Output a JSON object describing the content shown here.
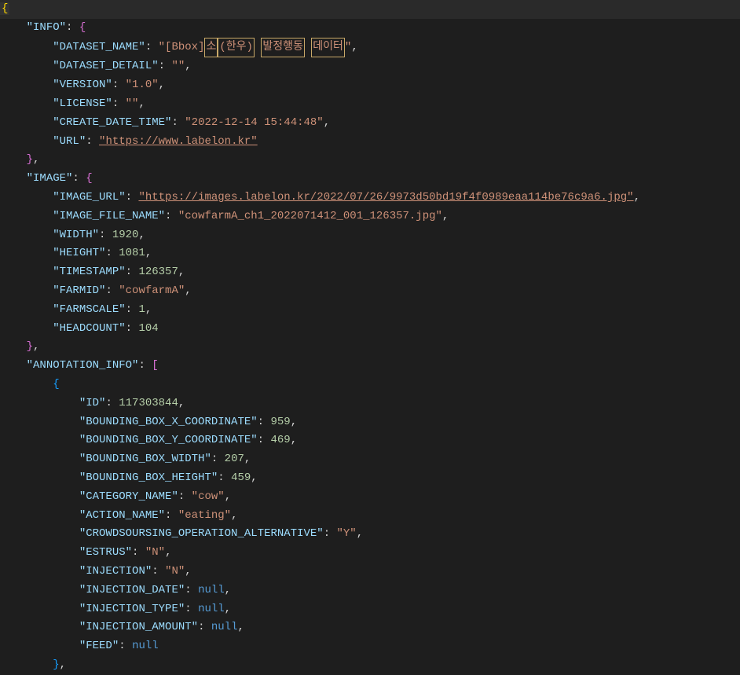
{
  "code": {
    "info_key": "\"INFO\"",
    "dataset_name_key": "\"DATASET_NAME\"",
    "dataset_name_val_prefix": "\"[Bbox]",
    "dataset_name_k1": "소",
    "dataset_name_k2": "(한우)",
    "dataset_name_k3": "발정행동",
    "dataset_name_k4": "데이터",
    "dataset_name_val_suffix": "\"",
    "dataset_detail_key": "\"DATASET_DETAIL\"",
    "dataset_detail_val": "\"\"",
    "version_key": "\"VERSION\"",
    "version_val": "\"1.0\"",
    "license_key": "\"LICENSE\"",
    "license_val": "\"\"",
    "create_date_key": "\"CREATE_DATE_TIME\"",
    "create_date_val": "\"2022-12-14 15:44:48\"",
    "url_key": "\"URL\"",
    "url_val": "\"https://www.labelon.kr\"",
    "image_key": "\"IMAGE\"",
    "image_url_key": "\"IMAGE_URL\"",
    "image_url_val": "\"https://images.labelon.kr/2022/07/26/9973d50bd19f4f0989eaa114be76c9a6.jpg\"",
    "image_file_name_key": "\"IMAGE_FILE_NAME\"",
    "image_file_name_val": "\"cowfarmA_ch1_2022071412_001_126357.jpg\"",
    "width_key": "\"WIDTH\"",
    "width_val": "1920",
    "height_key": "\"HEIGHT\"",
    "height_val": "1081",
    "timestamp_key": "\"TIMESTAMP\"",
    "timestamp_val": "126357",
    "farmid_key": "\"FARMID\"",
    "farmid_val": "\"cowfarmA\"",
    "farmscale_key": "\"FARMSCALE\"",
    "farmscale_val": "1",
    "headcount_key": "\"HEADCOUNT\"",
    "headcount_val": "104",
    "annotation_info_key": "\"ANNOTATION_INFO\"",
    "id_key": "\"ID\"",
    "id_val": "117303844",
    "bbox_x_key": "\"BOUNDING_BOX_X_COORDINATE\"",
    "bbox_x_val": "959",
    "bbox_y_key": "\"BOUNDING_BOX_Y_COORDINATE\"",
    "bbox_y_val": "469",
    "bbox_w_key": "\"BOUNDING_BOX_WIDTH\"",
    "bbox_w_val": "207",
    "bbox_h_key": "\"BOUNDING_BOX_HEIGHT\"",
    "bbox_h_val": "459",
    "category_key": "\"CATEGORY_NAME\"",
    "category_val": "\"cow\"",
    "action_key": "\"ACTION_NAME\"",
    "action_val": "\"eating\"",
    "crowd_key": "\"CROWDSOURSING_OPERATION_ALTERNATIVE\"",
    "crowd_val": "\"Y\"",
    "estrus_key": "\"ESTRUS\"",
    "estrus_val": "\"N\"",
    "injection_key": "\"INJECTION\"",
    "injection_val": "\"N\"",
    "injection_date_key": "\"INJECTION_DATE\"",
    "injection_date_val": "null",
    "injection_type_key": "\"INJECTION_TYPE\"",
    "injection_type_val": "null",
    "injection_amount_key": "\"INJECTION_AMOUNT\"",
    "injection_amount_val": "null",
    "feed_key": "\"FEED\"",
    "feed_val": "null"
  }
}
